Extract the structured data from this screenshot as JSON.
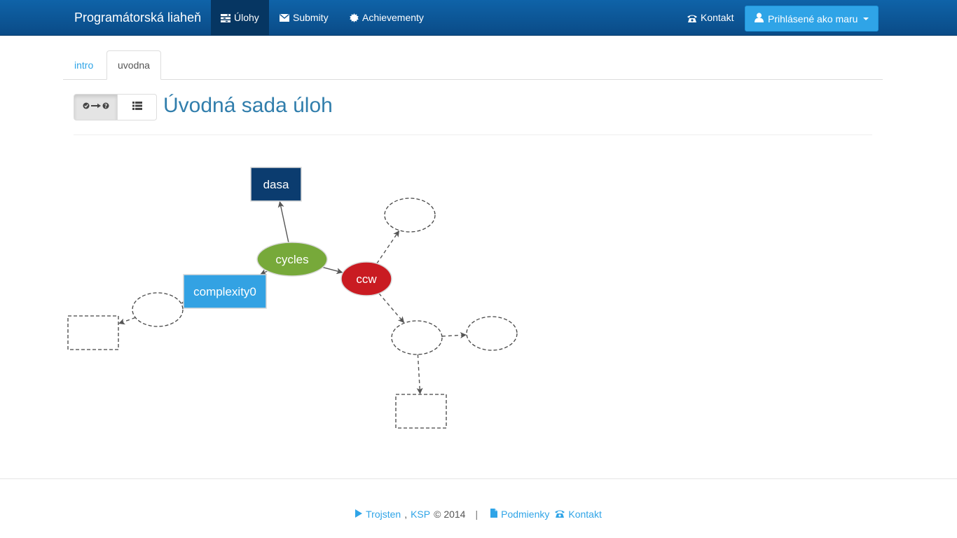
{
  "navbar": {
    "brand": "Programátorská liaheň",
    "items": [
      {
        "label": "Úlohy",
        "icon": "tasks-icon",
        "active": true
      },
      {
        "label": "Submity",
        "icon": "envelope-icon",
        "active": false
      },
      {
        "label": "Achievementy",
        "icon": "certificate-icon",
        "active": false
      }
    ],
    "contact_label": "Kontakt",
    "user_label": "Prihlásené ako maru"
  },
  "tabs": [
    {
      "label": "intro",
      "active": false
    },
    {
      "label": "uvodna",
      "active": true
    }
  ],
  "header": {
    "title": "Úvodná sada úloh"
  },
  "graph": {
    "nodes": [
      {
        "id": "dasa",
        "label": "dasa",
        "shape": "box",
        "state": "solved",
        "color": "#0b3c6f"
      },
      {
        "id": "cycles",
        "label": "cycles",
        "shape": "ellipse",
        "state": "solved",
        "color": "#77a93a"
      },
      {
        "id": "ccw",
        "label": "ccw",
        "shape": "ellipse",
        "state": "failed",
        "color": "#c91b22"
      },
      {
        "id": "complexity0",
        "label": "complexity0",
        "shape": "box",
        "state": "available",
        "color": "#33a2e3"
      },
      {
        "id": "hidden1",
        "label": "",
        "shape": "ellipse",
        "state": "locked"
      },
      {
        "id": "hidden2",
        "label": "",
        "shape": "ellipse",
        "state": "locked"
      },
      {
        "id": "hidden3",
        "label": "",
        "shape": "box",
        "state": "locked"
      },
      {
        "id": "hidden4",
        "label": "",
        "shape": "ellipse",
        "state": "locked"
      },
      {
        "id": "hidden5",
        "label": "",
        "shape": "ellipse",
        "state": "locked"
      },
      {
        "id": "hidden6",
        "label": "",
        "shape": "box",
        "state": "locked"
      }
    ],
    "edges": [
      {
        "from": "cycles",
        "to": "dasa",
        "style": "solid"
      },
      {
        "from": "cycles",
        "to": "ccw",
        "style": "solid"
      },
      {
        "from": "cycles",
        "to": "complexity0",
        "style": "solid"
      },
      {
        "from": "ccw",
        "to": "hidden1",
        "style": "dashed"
      },
      {
        "from": "ccw",
        "to": "hidden4",
        "style": "dashed"
      },
      {
        "from": "complexity0",
        "to": "hidden2",
        "style": "dashed"
      },
      {
        "from": "hidden2",
        "to": "hidden3",
        "style": "dashed"
      },
      {
        "from": "hidden4",
        "to": "hidden5",
        "style": "dashed"
      },
      {
        "from": "hidden4",
        "to": "hidden6",
        "style": "dashed"
      }
    ]
  },
  "footer": {
    "org1": "Trojsten",
    "org2": "KSP",
    "copyright": "© 2014",
    "separator": "|",
    "terms_label": "Podmienky",
    "contact_label": "Kontakt"
  }
}
